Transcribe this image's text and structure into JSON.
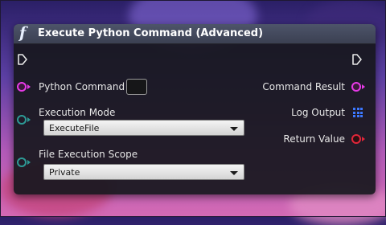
{
  "node": {
    "title": "Execute Python Command (Advanced)",
    "icon": "function-icon",
    "icon_glyph": "f"
  },
  "inputs": {
    "python_command": {
      "label": "Python Command",
      "value": ""
    },
    "execution_mode": {
      "label": "Execution Mode",
      "selected": "ExecuteFile"
    },
    "file_execution_scope": {
      "label": "File Execution Scope",
      "selected": "Private"
    }
  },
  "outputs": {
    "command_result": {
      "label": "Command Result"
    },
    "log_output": {
      "label": "Log Output"
    },
    "return_value": {
      "label": "Return Value"
    }
  },
  "colors": {
    "string_pin": "#e83ae8",
    "enum_pin": "#2d9a96",
    "bool_pin": "#e2263a",
    "array_pin": "#3c78ff"
  }
}
